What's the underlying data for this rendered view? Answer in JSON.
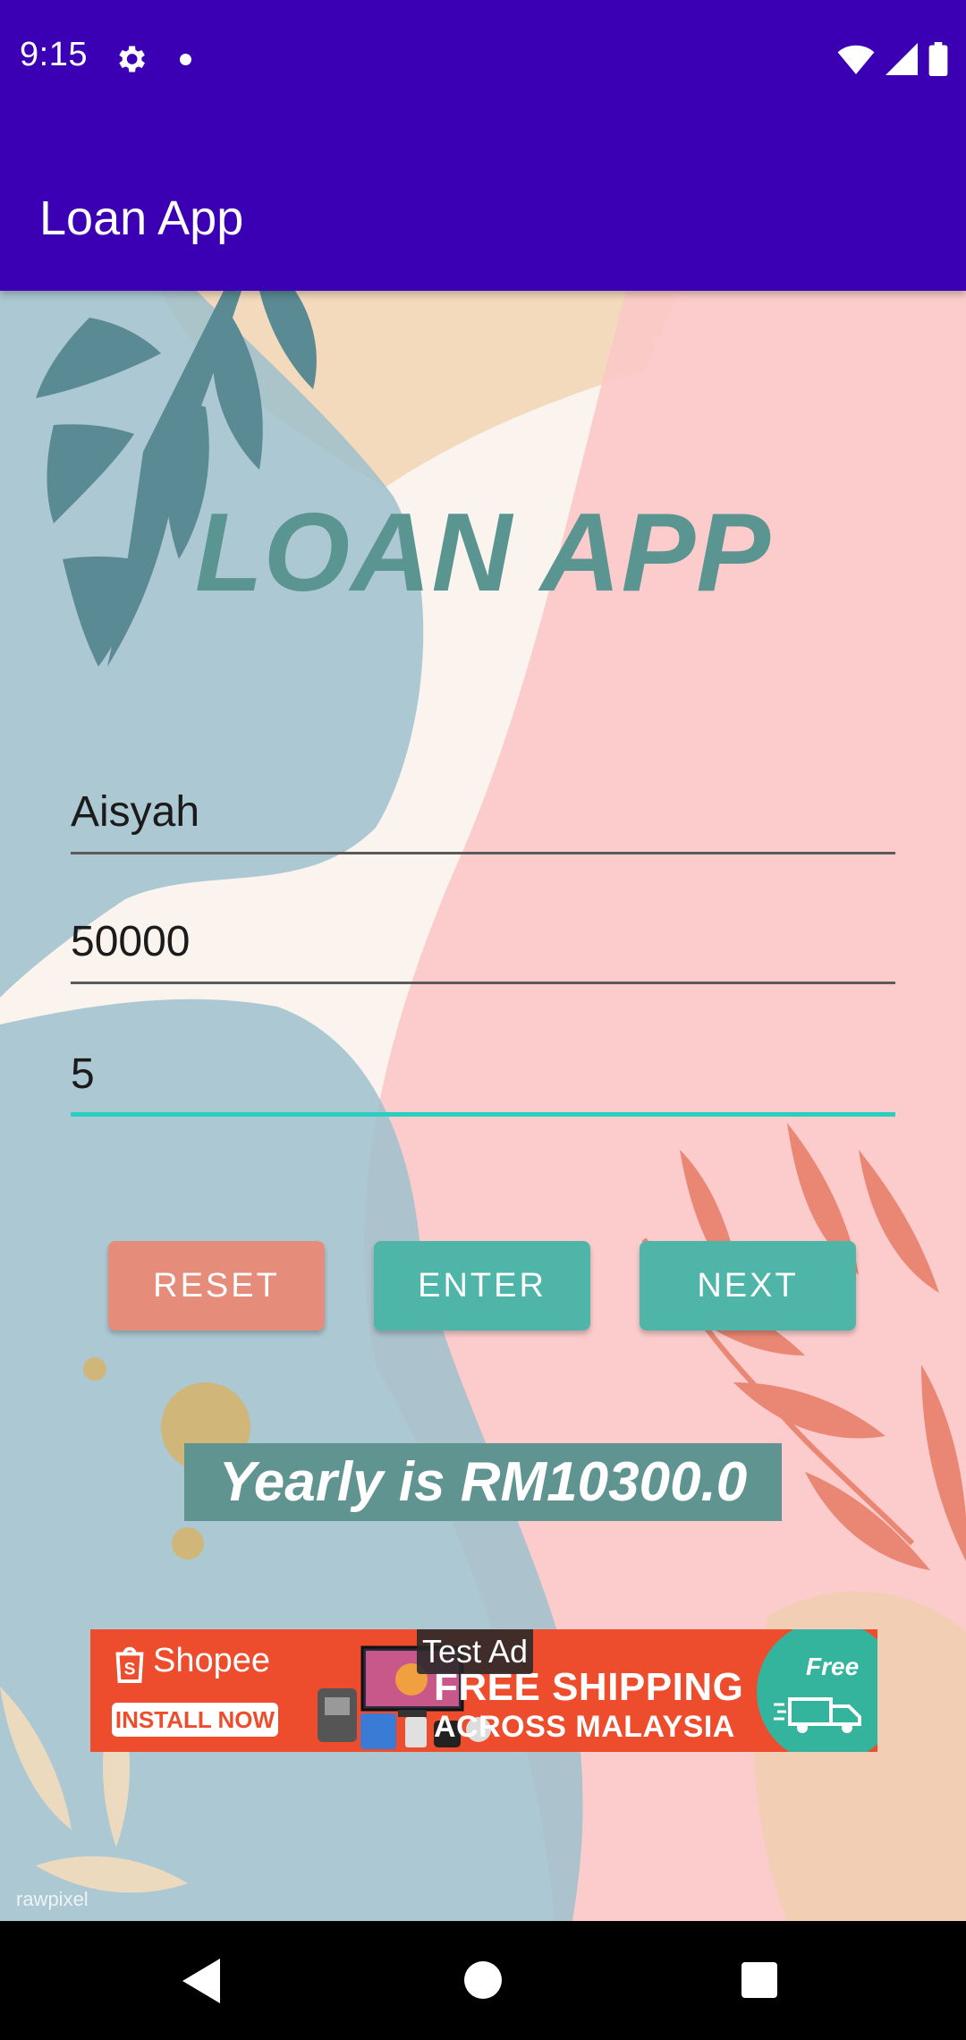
{
  "status_bar": {
    "time": "9:15",
    "icons": [
      "gear-icon",
      "notification-dot-icon",
      "wifi-icon",
      "signal-icon",
      "battery-icon"
    ]
  },
  "app_bar": {
    "title": "Loan App"
  },
  "main": {
    "title": "LOAN APP",
    "fields": [
      {
        "name": "name-field",
        "value": "Aisyah"
      },
      {
        "name": "amount-field",
        "value": "50000"
      },
      {
        "name": "years-field",
        "value": "5"
      }
    ],
    "buttons": {
      "reset": "RESET",
      "enter": "ENTER",
      "next": "NEXT"
    },
    "result": "Yearly is RM10300.0"
  },
  "ad": {
    "test_label": "Test Ad",
    "brand": "Shopee",
    "cta": "INSTALL NOW",
    "headline_1": "FREE SHIPPING",
    "headline_2": "ACROSS MALAYSIA",
    "badge": "Free"
  },
  "watermark": "rawpixel",
  "colors": {
    "primary": "#3b00b4",
    "teal": "#4fb5a9",
    "salmon": "#e68c7a",
    "focus_line": "#2bcfbf",
    "title_teal": "#5b9592"
  }
}
